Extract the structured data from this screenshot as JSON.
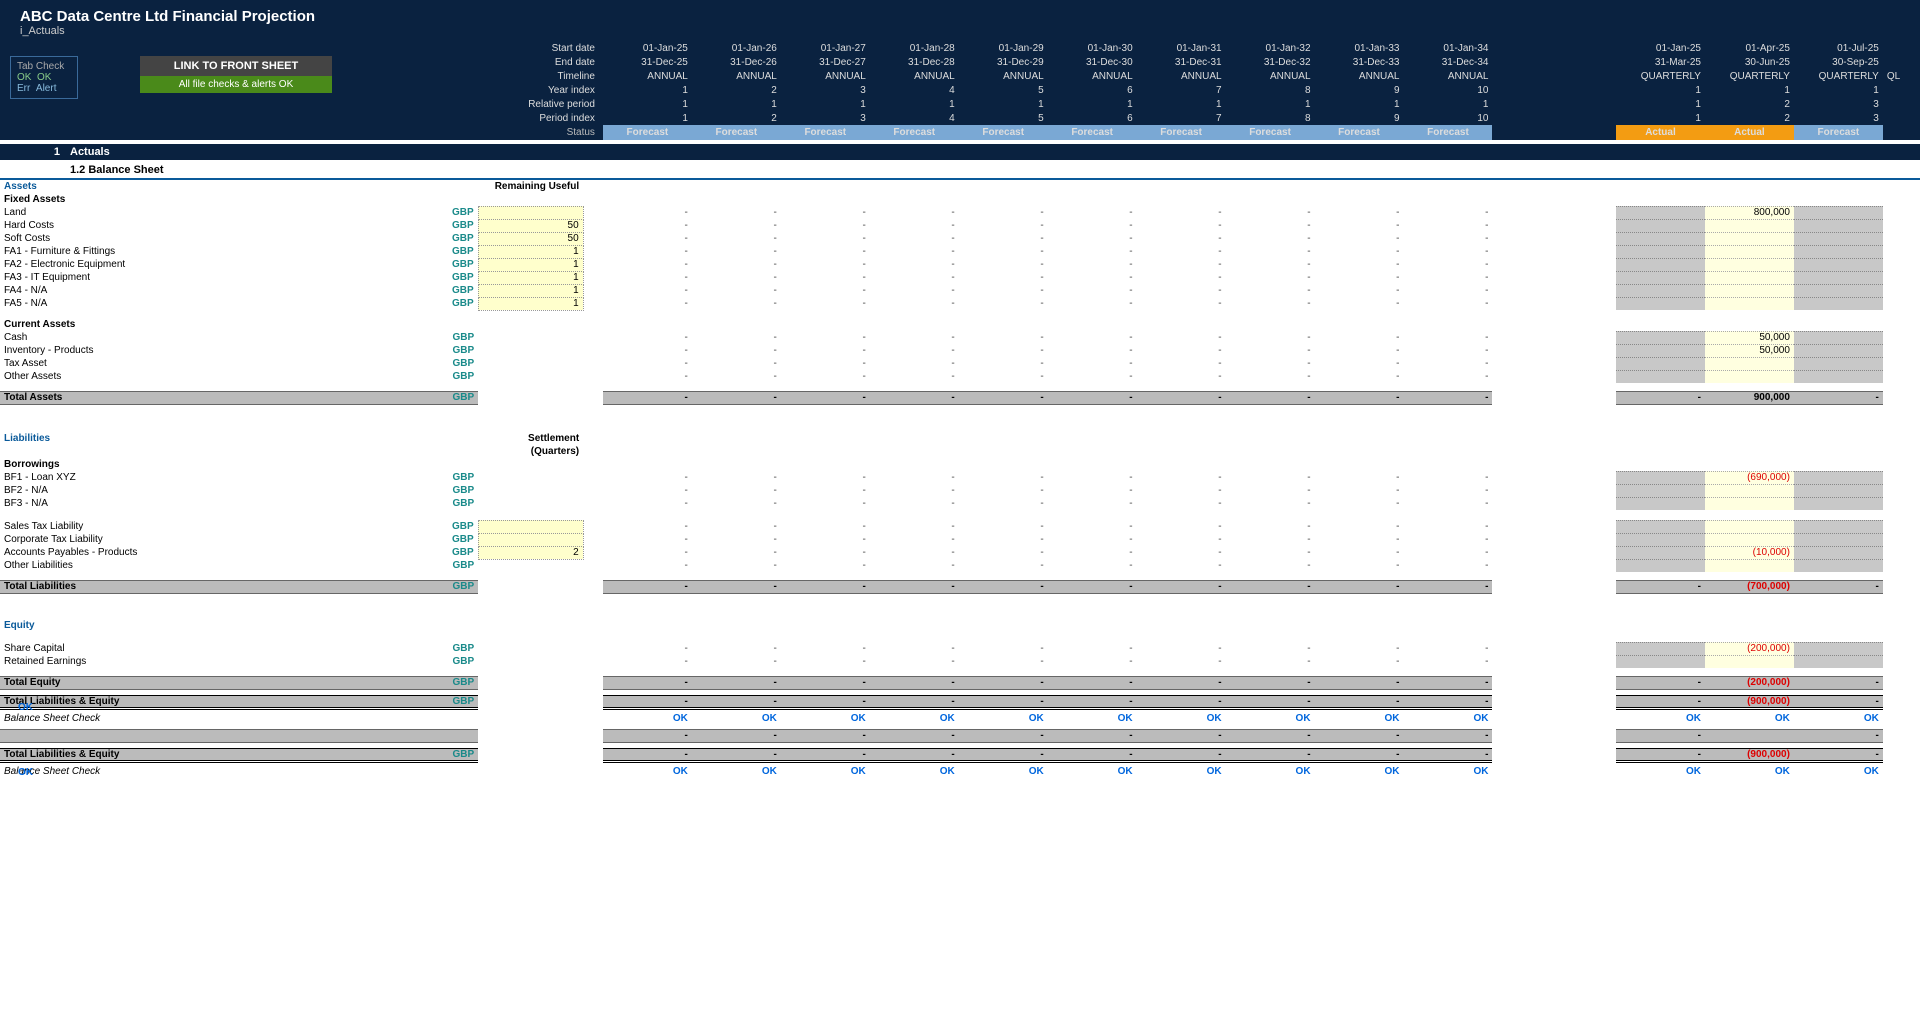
{
  "header": {
    "title": "ABC Data Centre Ltd Financial Projection",
    "subtitle": "i_Actuals",
    "rows": {
      "start": {
        "label": "Start date",
        "a": [
          "01-Jan-25",
          "01-Jan-26",
          "01-Jan-27",
          "01-Jan-28",
          "01-Jan-29",
          "01-Jan-30",
          "01-Jan-31",
          "01-Jan-32",
          "01-Jan-33",
          "01-Jan-34"
        ],
        "q": [
          "01-Jan-25",
          "01-Apr-25",
          "01-Jul-25"
        ]
      },
      "end": {
        "label": "End date",
        "a": [
          "31-Dec-25",
          "31-Dec-26",
          "31-Dec-27",
          "31-Dec-28",
          "31-Dec-29",
          "31-Dec-30",
          "31-Dec-31",
          "31-Dec-32",
          "31-Dec-33",
          "31-Dec-34"
        ],
        "q": [
          "31-Mar-25",
          "30-Jun-25",
          "30-Sep-25"
        ]
      },
      "timeline": {
        "label": "Timeline",
        "a": [
          "ANNUAL",
          "ANNUAL",
          "ANNUAL",
          "ANNUAL",
          "ANNUAL",
          "ANNUAL",
          "ANNUAL",
          "ANNUAL",
          "ANNUAL",
          "ANNUAL"
        ],
        "q": [
          "QUARTERLY",
          "QUARTERLY",
          "QUARTERLY"
        ]
      },
      "yidx": {
        "label": "Year index",
        "a": [
          "1",
          "2",
          "3",
          "4",
          "5",
          "6",
          "7",
          "8",
          "9",
          "10"
        ],
        "q": [
          "1",
          "1",
          "1"
        ]
      },
      "rel": {
        "label": "Relative period",
        "a": [
          "1",
          "1",
          "1",
          "1",
          "1",
          "1",
          "1",
          "1",
          "1",
          "1"
        ],
        "q": [
          "1",
          "2",
          "3"
        ]
      },
      "pidx": {
        "label": "Period index",
        "a": [
          "1",
          "2",
          "3",
          "4",
          "5",
          "6",
          "7",
          "8",
          "9",
          "10"
        ],
        "q": [
          "1",
          "2",
          "3"
        ]
      },
      "status": {
        "label": "Status",
        "a": [
          "Forecast",
          "Forecast",
          "Forecast",
          "Forecast",
          "Forecast",
          "Forecast",
          "Forecast",
          "Forecast",
          "Forecast",
          "Forecast"
        ],
        "q": [
          "Actual",
          "Actual",
          "Forecast"
        ]
      }
    }
  },
  "tabcheck": {
    "title": "Tab Check",
    "ok1": "OK",
    "ok2": "OK",
    "err": "Err",
    "alert": "Alert"
  },
  "linkbox": {
    "btn": "LINK TO FRONT SHEET",
    "ok": "All file checks & alerts OK"
  },
  "section": {
    "num": "1",
    "title": "Actuals",
    "sub": "1.2   Balance Sheet"
  },
  "labels": {
    "assets": "Assets",
    "fixed": "Fixed Assets",
    "remain": "Remaining Useful",
    "land": "Land",
    "hard": "Hard Costs",
    "soft": "Soft Costs",
    "fa1": "FA1 - Furniture & Fittings",
    "fa2": "FA2 - Electronic Equipment",
    "fa3": "FA3 - IT Equipment",
    "fa4": "FA4 - N/A",
    "fa5": "FA5 - N/A",
    "current": "Current Assets",
    "cash": "Cash",
    "inv": "Inventory - Products",
    "tax": "Tax Asset",
    "other": "Other Assets",
    "totassets": "Total Assets",
    "liab": "Liabilities",
    "settle": "Settlement",
    "settle2": "(Quarters)",
    "borrow": "Borrowings",
    "bf1": "BF1 - Loan XYZ",
    "bf2": "BF2 - N/A",
    "bf3": "BF3 - N/A",
    "stax": "Sales Tax Liability",
    "corptax": "Corporate Tax Liability",
    "ap": "Accounts Payables - Products",
    "oliab": "Other Liabilities",
    "totliab": "Total Liabilities",
    "equity": "Equity",
    "share": "Share Capital",
    "retained": "Retained Earnings",
    "toteq": "Total Equity",
    "totle": "Total Liabilities & Equity",
    "check": "Balance Sheet Check",
    "gbp": "GBP",
    "ok": "OK"
  },
  "vals": {
    "hard": "50",
    "soft": "50",
    "fa1": "1",
    "fa2": "1",
    "fa3": "1",
    "fa4": "1",
    "fa5": "1",
    "ap": "2",
    "q2_land": "800,000",
    "q2_cash": "50,000",
    "q2_inv": "50,000",
    "q2_totassets": "900,000",
    "q2_bf1": "(690,000)",
    "q2_ap": "(10,000)",
    "q2_totliab": "(700,000)",
    "q2_share": "(200,000)",
    "q2_toteq": "(200,000)",
    "q2_totle": "(900,000)",
    "q2_dup": "(900,000)",
    "dash": "-"
  },
  "qlast": "QL"
}
